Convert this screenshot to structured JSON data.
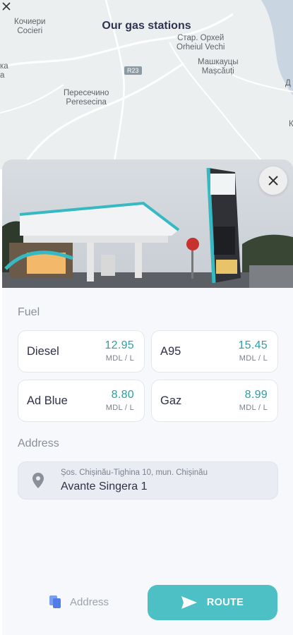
{
  "map": {
    "title": "Our gas stations",
    "road_number": "R23",
    "labels": [
      {
        "name": "place-cocieri",
        "lines": [
          "Кочиери",
          "Cocieri"
        ]
      },
      {
        "name": "place-fragment-left",
        "lines": [
          "ка",
          "a"
        ]
      },
      {
        "name": "place-oreheiul-vechi",
        "lines": [
          "Стар. Орхей",
          "Orheiul Vechi"
        ]
      },
      {
        "name": "place-mascauti",
        "lines": [
          "Машкауцы",
          "Mașcăuți"
        ]
      },
      {
        "name": "place-peresecina",
        "lines": [
          "Пересечино",
          "Peresecina"
        ]
      },
      {
        "name": "place-fragment-right-d",
        "lines": [
          "Д"
        ]
      },
      {
        "name": "place-fragment-right-k",
        "lines": [
          "К"
        ]
      }
    ]
  },
  "station": {
    "fuel_section_title": "Fuel",
    "fuels": [
      {
        "name": "Diesel",
        "price": "12.95",
        "unit": "MDL / L"
      },
      {
        "name": "A95",
        "price": "15.45",
        "unit": "MDL / L"
      },
      {
        "name": "Ad Blue",
        "price": "8.80",
        "unit": "MDL / L"
      },
      {
        "name": "Gaz",
        "price": "8.99",
        "unit": "MDL / L"
      }
    ],
    "address_section_title": "Address",
    "address_line": "Șos. Chișinău-Tighina 10, mun. Chișinău",
    "station_name": "Avante Singera 1"
  },
  "actions": {
    "copy_address_label": "Address",
    "route_label": "ROUTE"
  },
  "colors": {
    "accent": "#4cc0c4",
    "price": "#2aa0a6",
    "text_dark": "#2f3146"
  },
  "icons": [
    "back-arrow-icon",
    "close-icon",
    "location-pin-icon",
    "copy-icon",
    "send-icon"
  ]
}
